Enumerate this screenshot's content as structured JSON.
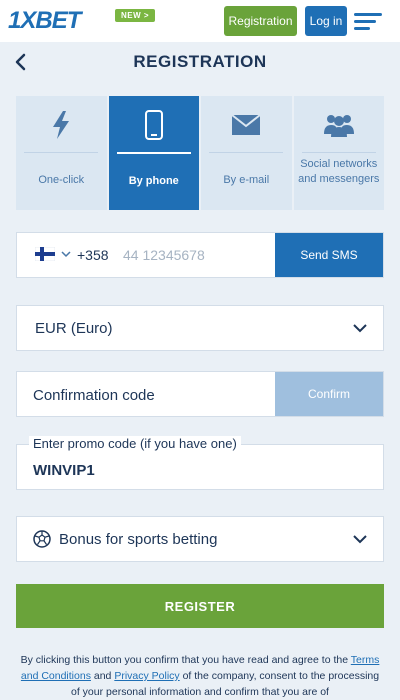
{
  "header": {
    "logo_text": "1XBET",
    "new_badge": "NEW >",
    "registration_label": "Registration",
    "login_label": "Log in",
    "menu_icon": "hamburger-menu-icon"
  },
  "page": {
    "title": "REGISTRATION",
    "back_icon": "chevron-left-icon"
  },
  "tabs": [
    {
      "label": "One-click",
      "icon": "lightning-icon",
      "active": false
    },
    {
      "label": "By phone",
      "icon": "phone-icon",
      "active": true
    },
    {
      "label": "By e-mail",
      "icon": "envelope-icon",
      "active": false
    },
    {
      "label": "Social networks and messengers",
      "icon": "people-icon",
      "active": false
    }
  ],
  "phone": {
    "country_icon": "finland-flag-icon",
    "dial_code": "+358",
    "placeholder": "44 12345678",
    "value": "",
    "send_sms_label": "Send SMS"
  },
  "currency": {
    "value": "EUR (Euro)"
  },
  "confirmation": {
    "placeholder": "Confirmation code",
    "confirm_label": "Confirm"
  },
  "promo": {
    "label": "Enter promo code (if you have one)",
    "value": "WINVIP1"
  },
  "bonus": {
    "value": "Bonus for sports betting",
    "icon": "soccer-ball-icon"
  },
  "register_label": "REGISTER",
  "terms": {
    "text_before": "By clicking this button you confirm that you have read and agree to the ",
    "terms_link": "Terms and Conditions",
    "text_and": " and ",
    "privacy_link": "Privacy Policy",
    "text_after": " of the company, consent to the processing of your personal information and confirm that you are of"
  },
  "colors": {
    "brand_blue": "#1f6fb5",
    "green": "#6aa33a",
    "background": "#eaf0f6"
  }
}
